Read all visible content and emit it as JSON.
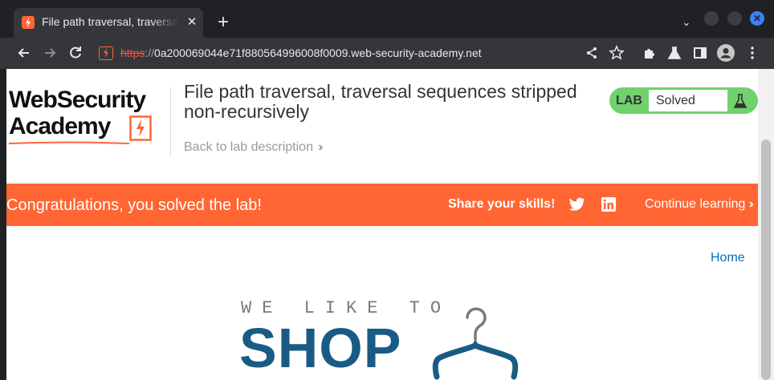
{
  "browser": {
    "tab": {
      "title": "File path traversal, traversal sequences stripped non-recursively",
      "close": "✕"
    },
    "new_tab": "+",
    "tab_search": "⌄",
    "url": {
      "scheme": "https",
      "separator": "://",
      "rest": "0a200069044e71f880564996008f0009.web-security-academy.net"
    }
  },
  "header": {
    "logo_line1": "WebSecurity",
    "logo_line2": "Academy",
    "lab_title": "File path traversal, traversal sequences stripped non-recursively",
    "back_link": "Back to lab description",
    "status": {
      "label": "LAB",
      "value": "Solved"
    }
  },
  "banner": {
    "message": "Congratulations, you solved the lab!",
    "share_label": "Share your skills!",
    "continue_label": "Continue learning"
  },
  "nav": {
    "home": "Home"
  },
  "shop_logo": {
    "tagline": "WE LIKE TO",
    "word": "SHOP"
  },
  "colors": {
    "accent": "#ff6633",
    "status_green": "#70d16d",
    "link_blue": "#0071bc",
    "shop_blue": "#1a5b85",
    "url_insecure": "#e8594c"
  },
  "icons": {
    "favicon": "lightning-icon",
    "share": "share-icon",
    "bookmark": "star-icon",
    "extensions": "puzzle-icon",
    "lab": "flask-icon",
    "side_panel": "side-panel-icon",
    "profile": "avatar-icon",
    "menu": "kebab-menu-icon"
  }
}
